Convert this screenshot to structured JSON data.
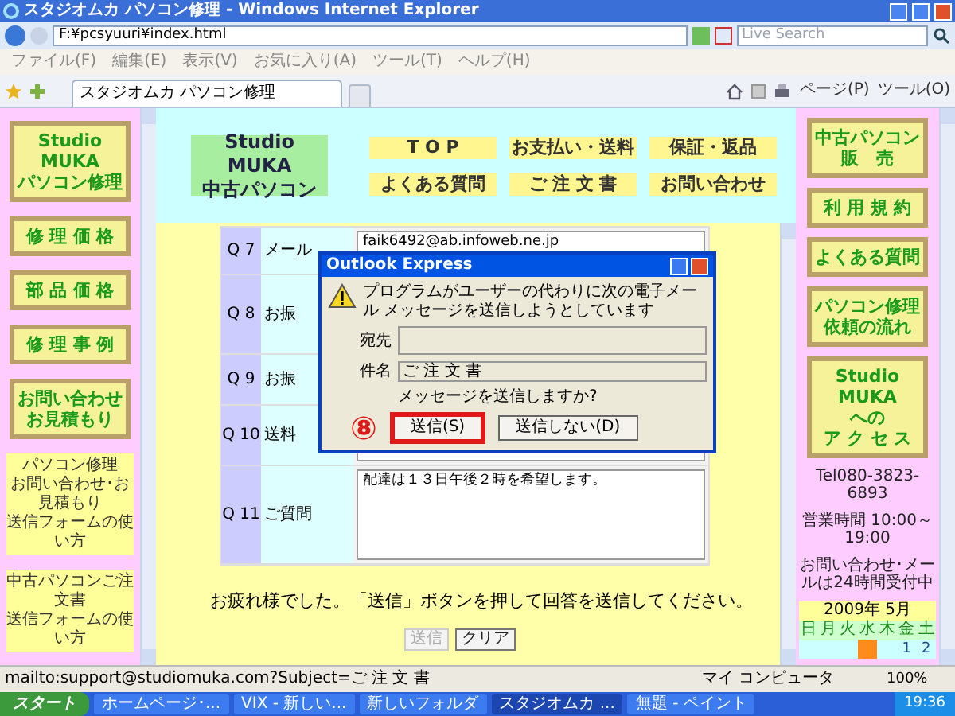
{
  "window": {
    "title": "スタジオムカ パソコン修理 - Windows Internet Explorer"
  },
  "address_bar": {
    "url": "F:¥pcsyuuri¥index.html"
  },
  "search": {
    "placeholder": "Live Search"
  },
  "menu": [
    "ファイル(F)",
    "編集(E)",
    "表示(V)",
    "お気に入り(A)",
    "ツール(T)",
    "ヘルプ(H)"
  ],
  "tabs": [
    {
      "label": "スタジオムカ パソコン修理",
      "selected": true
    }
  ],
  "command_bar": [
    "ページ(P)",
    "ツール(O)"
  ],
  "left_nav": [
    {
      "kind": "button",
      "lines": [
        "Studio MUKA",
        "パソコン修理"
      ]
    },
    {
      "kind": "button",
      "lines": [
        "修 理 価 格"
      ]
    },
    {
      "kind": "button",
      "lines": [
        "部 品 価 格"
      ]
    },
    {
      "kind": "button",
      "lines": [
        "修 理 事 例"
      ]
    },
    {
      "kind": "button",
      "lines": [
        "お問い合わせ",
        "お見積もり"
      ]
    },
    {
      "kind": "note",
      "lines": [
        "パソコン修理",
        "お問い合わせ･お見積もり",
        "送信フォームの使い方"
      ]
    },
    {
      "kind": "note",
      "lines": [
        "中古パソコンご注文書",
        "送信フォームの使い方"
      ]
    }
  ],
  "header": {
    "logo": [
      "Studio MUKA",
      "中古パソコン"
    ],
    "nav": [
      "T O P",
      "お支払い・送料",
      "保証・返品",
      "よくある質問",
      "ご 注 文 書",
      "お問い合わせ"
    ]
  },
  "form": {
    "questions": [
      {
        "number": "Q 7",
        "label": "メール",
        "value": "faik6492@ab.infoweb.ne.jp"
      },
      {
        "number": "Q 8",
        "label": "お振"
      },
      {
        "number": "Q 9",
        "label": "お振"
      },
      {
        "number": "Q 10",
        "label": "送料"
      },
      {
        "number": "Q 11",
        "label": "ご質問",
        "value": "配達は１３日午後２時を希望します。"
      }
    ],
    "note": "お疲れ様でした。「送信」ボタンを押して回答を送信してください。",
    "buttons": [
      {
        "label": "送信",
        "disabled": true
      },
      {
        "label": "クリア",
        "disabled": false
      }
    ]
  },
  "right_nav": [
    {
      "kind": "button",
      "lines": [
        "中古パソコン",
        "販　売"
      ]
    },
    {
      "kind": "button",
      "lines": [
        "利 用 規 約"
      ]
    },
    {
      "kind": "button",
      "lines": [
        "よくある質問"
      ]
    },
    {
      "kind": "button",
      "lines": [
        "パソコン修理",
        "依頼の流れ"
      ]
    },
    {
      "kind": "button",
      "lines": [
        "Studio MUKA",
        "への",
        "ア ク セ ス"
      ]
    },
    {
      "kind": "info",
      "lines": [
        "Tel080-3823-6893"
      ]
    },
    {
      "kind": "info",
      "lines": [
        "営業時間 10:00～19:00"
      ]
    },
    {
      "kind": "info",
      "lines": [
        "お問い合わせ･メールは24時間受付中"
      ]
    }
  ],
  "calendar": {
    "title": "2009年 5月",
    "weekdays": [
      "日",
      "月",
      "火",
      "水",
      "木",
      "金",
      "土"
    ],
    "first_week": [
      {
        "highlighted": false
      },
      {
        "highlighted": false
      },
      {
        "highlighted": false
      },
      {
        "highlighted": true
      },
      {
        "highlighted": false
      },
      {
        "text": "1",
        "highlighted": false
      },
      {
        "text": "2",
        "highlighted": false
      }
    ]
  },
  "dialog": {
    "title": "Outlook Express",
    "message": "プログラムがユーザーの代わりに次の電子メール メッセージを送信しようとしています",
    "to_label": "宛先",
    "subject_label": "件名",
    "subject": "ご 注 文 書",
    "question": "メッセージを送信しますか?",
    "annotation": "⑧",
    "buttons": [
      {
        "label": "送信(S)",
        "annotated": true
      },
      {
        "label": "送信しない(D)",
        "annotated": false
      }
    ]
  },
  "status_bar": {
    "text": "mailto:support@studiomuka.com?Subject=ご 注 文 書",
    "zone": "マイ コンピュータ",
    "zoom": "100%"
  },
  "taskbar": {
    "start": "スタート",
    "items": [
      {
        "label": "ホームページ･...",
        "selected": false
      },
      {
        "label": "VIX - 新しい...",
        "selected": false
      },
      {
        "label": "新しいフォルダ",
        "selected": false
      },
      {
        "label": "スタジオムカ ...",
        "selected": true
      },
      {
        "label": "無題 - ペイント",
        "selected": false
      }
    ],
    "clock": "19:36"
  }
}
